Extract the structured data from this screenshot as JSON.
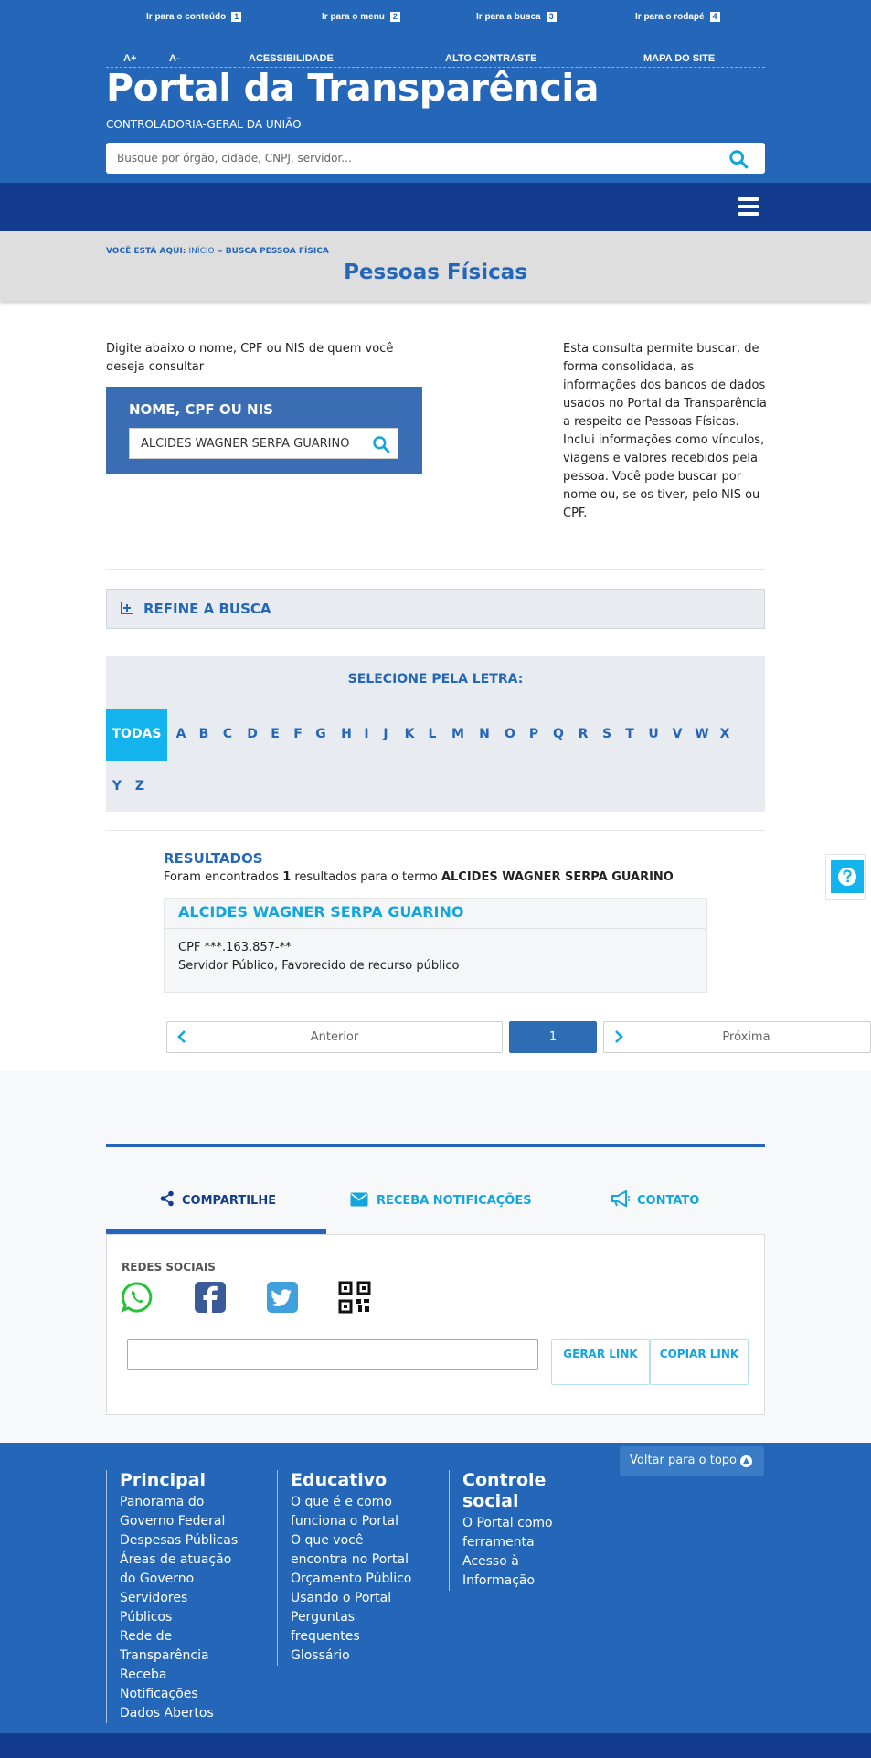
{
  "header": {
    "skip_links": [
      {
        "label": "Ir para o conteúdo",
        "key": "1"
      },
      {
        "label": "Ir para o menu",
        "key": "2"
      },
      {
        "label": "Ir para a busca",
        "key": "3"
      },
      {
        "label": "Ir para o rodapé",
        "key": "4"
      }
    ],
    "util_links": [
      "A+",
      "A-",
      "ACESSIBILIDADE",
      "ALTO CONTRASTE",
      "MAPA DO SITE"
    ],
    "title": "Portal da Transparência",
    "subtitle": "CONTROLADORIA-GERAL DA UNIÃO",
    "search_placeholder": "Busque por órgão, cidade, CNPJ, servidor..."
  },
  "breadcrumb": {
    "prefix": "VOCÊ ESTÁ AQUI:",
    "home": "INÍCIO",
    "separator": "»",
    "current": "BUSCA PESSOA FÍSICA"
  },
  "page_title": "Pessoas Físicas",
  "search": {
    "intro": "Digite abaixo o nome, CPF ou NIS de quem você deseja consultar",
    "label": "NOME, CPF OU NIS",
    "value": "ALCIDES WAGNER SERPA GUARINO",
    "description": "Esta consulta permite buscar, de forma consolidada, as informações dos bancos de dados usados no Portal da Transparência a respeito de Pessoas Físicas. Inclui informações como vínculos, viagens e valores recebidos pela pessoa. Você pode buscar por nome ou, se os tiver, pelo NIS ou CPF."
  },
  "refine": {
    "label": "REFINE A BUSCA"
  },
  "letters": {
    "title": "SELECIONE PELA LETRA:",
    "items": [
      "TODAS",
      "A",
      "B",
      "C",
      "D",
      "E",
      "F",
      "G",
      "H",
      "I",
      "J",
      "K",
      "L",
      "M",
      "N",
      "O",
      "P",
      "Q",
      "R",
      "S",
      "T",
      "U",
      "V",
      "W",
      "X",
      "Y",
      "Z"
    ],
    "active": "TODAS"
  },
  "results": {
    "title": "RESULTADOS",
    "count_prefix": "Foram encontrados",
    "count": "1",
    "count_middle": "resultados para o termo",
    "term": "ALCIDES WAGNER SERPA GUARINO",
    "items": [
      {
        "name": "ALCIDES WAGNER SERPA GUARINO",
        "cpf": "CPF ***.163.857-**",
        "type": "Servidor Público, Favorecido de recurso público"
      }
    ]
  },
  "pagination": {
    "prev": "Anterior",
    "current": "1",
    "next": "Próxima"
  },
  "share": {
    "tabs": [
      "COMPARTILHE",
      "RECEBA NOTIFICAÇÕES",
      "CONTATO"
    ],
    "active_tab": "COMPARTILHE",
    "social_label": "REDES SOCIAIS",
    "social_icons": [
      "whatsapp-icon",
      "facebook-icon",
      "twitter-icon",
      "qr-code-icon"
    ],
    "gerar_link": "GERAR LINK",
    "copiar_link": "COPIAR LINK"
  },
  "footer": {
    "back_to_top": "Voltar para o topo",
    "columns": [
      {
        "title": "Principal",
        "links": [
          "Panorama do Governo Federal",
          "Despesas Públicas",
          "Áreas de atuação do Governo",
          "Servidores Públicos",
          "Rede de Transparência",
          "Receba Notificações",
          "Dados Abertos"
        ]
      },
      {
        "title": "Educativo",
        "links": [
          "O que é e como funciona o Portal",
          "O que você encontra no Portal",
          "Orçamento Público",
          "Usando o Portal",
          "Perguntas frequentes",
          "Glossário"
        ]
      },
      {
        "title": "Controle social",
        "links": [
          "O Portal como ferramenta",
          "Acesso à Informação"
        ]
      }
    ]
  },
  "colors": {
    "header_blue": "#2467b8",
    "nav_dark": "#133c8f",
    "accent_cyan": "#13b3ee",
    "footer_blue": "#2467b8"
  }
}
